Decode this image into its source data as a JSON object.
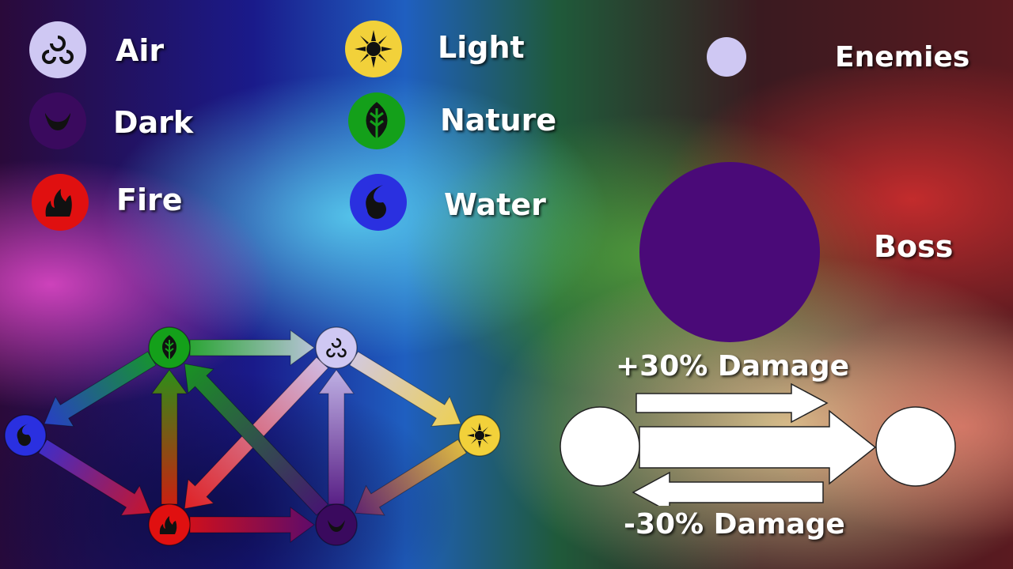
{
  "legend": {
    "items": [
      {
        "label": "Air",
        "icon": "air-swirl-icon",
        "color": "#cfc8f3"
      },
      {
        "label": "Dark",
        "icon": "dark-moon-icon",
        "color": "#3a0a5e"
      },
      {
        "label": "Fire",
        "icon": "fire-flame-icon",
        "color": "#e01010"
      },
      {
        "label": "Light",
        "icon": "light-sun-icon",
        "color": "#f2d13a"
      },
      {
        "label": "Nature",
        "icon": "nature-leaf-icon",
        "color": "#14a01a"
      },
      {
        "label": "Water",
        "icon": "water-drop-icon",
        "color": "#2a30e0"
      }
    ]
  },
  "enemies": {
    "label": "Enemies",
    "dot_color": "#cfc8f3"
  },
  "boss": {
    "label": "Boss",
    "color": "#4a0a78"
  },
  "damage": {
    "plus_label": "+30% Damage",
    "minus_label": "-30% Damage"
  }
}
